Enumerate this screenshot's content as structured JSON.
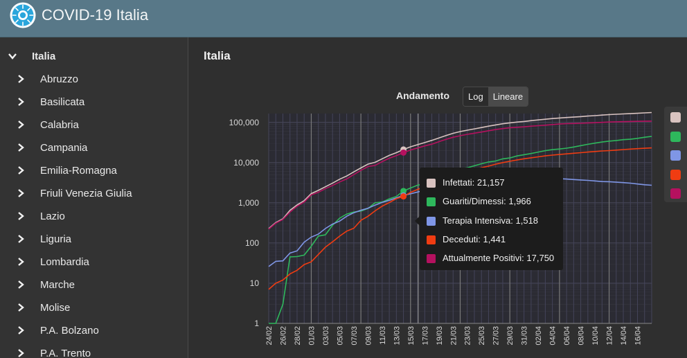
{
  "app": {
    "title": "COVID-19 Italia",
    "logo_icon": "virus-icon"
  },
  "sidebar": {
    "root": {
      "label": "Italia",
      "icon": "chevron-down-icon"
    },
    "items": [
      {
        "label": "Abruzzo"
      },
      {
        "label": "Basilicata"
      },
      {
        "label": "Calabria"
      },
      {
        "label": "Campania"
      },
      {
        "label": "Emilia-Romagna"
      },
      {
        "label": "Friuli Venezia Giulia"
      },
      {
        "label": "Lazio"
      },
      {
        "label": "Liguria"
      },
      {
        "label": "Lombardia"
      },
      {
        "label": "Marche"
      },
      {
        "label": "Molise"
      },
      {
        "label": "P.A. Bolzano"
      },
      {
        "label": "P.A. Trento"
      }
    ]
  },
  "main": {
    "title": "Italia",
    "chart_title": "Andamento",
    "scale_buttons": [
      {
        "label": "Log",
        "active": false
      },
      {
        "label": "Lineare",
        "active": true
      }
    ]
  },
  "tooltip": {
    "rows": [
      {
        "label": "Infettati: 21,157",
        "color": "#d9c3c0"
      },
      {
        "label": "Guariti/Dimessi: 1,966",
        "color": "#2eb85c"
      },
      {
        "label": "Terapia Intensiva: 1,518",
        "color": "#7f96e6"
      },
      {
        "label": "Deceduti: 1,441",
        "color": "#f03c12"
      },
      {
        "label": "Attualmente Positivi: 17,750",
        "color": "#b5115f"
      }
    ]
  },
  "chart_data": {
    "type": "line",
    "scale": "log",
    "y_ticks": [
      "1",
      "10",
      "100",
      "1,000",
      "10,000",
      "100,000"
    ],
    "ylim": [
      1,
      100000
    ],
    "x_tick_labels": [
      "24/02",
      "26/02",
      "28/02",
      "01/03",
      "03/03",
      "05/03",
      "07/03",
      "09/03",
      "11/03",
      "13/03",
      "15/03",
      "17/03",
      "19/03",
      "21/03",
      "23/03",
      "25/03",
      "27/03",
      "29/03",
      "31/03",
      "02/04",
      "04/04",
      "06/04",
      "08/04",
      "10/04",
      "12/04",
      "14/04",
      "16/04"
    ],
    "x": [
      "24/02",
      "25/02",
      "26/02",
      "27/02",
      "28/02",
      "29/02",
      "01/03",
      "02/03",
      "03/03",
      "04/03",
      "05/03",
      "06/03",
      "07/03",
      "08/03",
      "09/03",
      "10/03",
      "11/03",
      "12/03",
      "13/03",
      "14/03",
      "15/03",
      "16/03",
      "17/03",
      "18/03",
      "19/03",
      "20/03",
      "21/03",
      "22/03",
      "23/03",
      "24/03",
      "25/03",
      "26/03",
      "27/03",
      "28/03",
      "29/03",
      "30/03",
      "31/03",
      "01/04",
      "02/04",
      "03/04",
      "04/04",
      "05/04",
      "06/04",
      "07/04",
      "08/04",
      "09/04",
      "10/04",
      "11/04",
      "12/04",
      "13/04",
      "14/04",
      "15/04",
      "16/04",
      "17/04",
      "18/04"
    ],
    "highlight_index": 20,
    "series": [
      {
        "name": "Infettati",
        "color": "#d9c3c0",
        "values": [
          229,
          322,
          400,
          650,
          888,
          1128,
          1694,
          2036,
          2502,
          3089,
          3858,
          4636,
          5883,
          7375,
          9172,
          10149,
          12462,
          15113,
          17660,
          21157,
          24747,
          27980,
          31506,
          35713,
          41035,
          47021,
          53578,
          59138,
          63927,
          69176,
          74386,
          80539,
          86498,
          92472,
          97689,
          101739,
          105792,
          110574,
          115242,
          119827,
          124632,
          128948,
          132547,
          135586,
          139422,
          143626,
          147577,
          152271,
          156363,
          159516,
          162488,
          165155,
          168941,
          172434,
          175925
        ]
      },
      {
        "name": "Guariti/Dimessi",
        "color": "#2eb85c",
        "values": [
          1,
          1,
          3,
          45,
          46,
          50,
          83,
          149,
          160,
          276,
          414,
          523,
          589,
          622,
          724,
          1004,
          1045,
          1258,
          1439,
          1966,
          2335,
          2749,
          2941,
          4025,
          4440,
          5129,
          6072,
          7024,
          7432,
          8326,
          9362,
          10361,
          10950,
          12384,
          13030,
          14620,
          15729,
          16847,
          18278,
          19758,
          20996,
          21815,
          22837,
          24392,
          26491,
          28470,
          30455,
          32534,
          34211,
          35435,
          37130,
          38092,
          40164,
          42727,
          44927
        ]
      },
      {
        "name": "Terapia Intensiva",
        "color": "#7f96e6",
        "values": [
          26,
          35,
          36,
          56,
          64,
          105,
          140,
          166,
          229,
          295,
          351,
          462,
          567,
          650,
          733,
          877,
          1028,
          1153,
          1328,
          1518,
          1672,
          1851,
          2060,
          2257,
          2498,
          2655,
          2857,
          3009,
          3204,
          3396,
          3489,
          3612,
          3732,
          3856,
          3906,
          3981,
          4023,
          4035,
          4053,
          4068,
          3994,
          3977,
          3898,
          3792,
          3693,
          3605,
          3497,
          3381,
          3343,
          3260,
          3186,
          3079,
          2936,
          2812,
          2733
        ]
      },
      {
        "name": "Deceduti",
        "color": "#f03c12",
        "values": [
          7,
          10,
          12,
          17,
          21,
          29,
          34,
          52,
          79,
          107,
          148,
          197,
          233,
          366,
          463,
          631,
          827,
          1016,
          1266,
          1441,
          1809,
          2158,
          2503,
          2978,
          3405,
          4032,
          4825,
          5476,
          6077,
          6820,
          7503,
          8165,
          9134,
          10023,
          10779,
          11591,
          12428,
          13155,
          13915,
          14681,
          15362,
          15887,
          16523,
          17127,
          17669,
          18279,
          18849,
          19468,
          19899,
          20465,
          21067,
          21645,
          22170,
          22745,
          23227
        ]
      },
      {
        "name": "Attualmente Positivi",
        "color": "#b5115f",
        "values": [
          221,
          311,
          385,
          588,
          821,
          1049,
          1577,
          1835,
          2263,
          2706,
          3296,
          3916,
          5061,
          6387,
          7985,
          8514,
          10590,
          12839,
          14955,
          17750,
          20603,
          23073,
          26062,
          28710,
          33190,
          37860,
          42681,
          46638,
          50418,
          54030,
          57521,
          62013,
          66414,
          70065,
          73880,
          75528,
          77635,
          80572,
          83049,
          85388,
          88274,
          91246,
          93187,
          94067,
          95262,
          96877,
          98273,
          100269,
          102253,
          103616,
          104291,
          105418,
          106607,
          106962,
          107771
        ]
      }
    ]
  }
}
